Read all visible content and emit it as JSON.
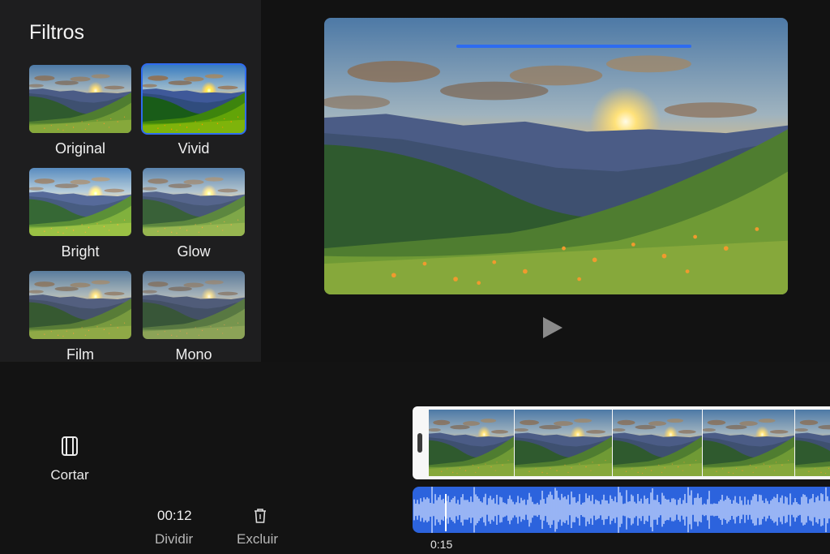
{
  "panel": {
    "title": "Filtros"
  },
  "filters": [
    {
      "label": "Original",
      "selected": false
    },
    {
      "label": "Vivid",
      "selected": true
    },
    {
      "label": "Bright",
      "selected": false
    },
    {
      "label": "Glow",
      "selected": false
    },
    {
      "label": "Film",
      "selected": false
    },
    {
      "label": "Mono",
      "selected": false
    }
  ],
  "preview": {
    "progress_fraction": 0.5
  },
  "controls": {
    "play_icon": "play-icon"
  },
  "tools": {
    "crop_label": "Cortar",
    "crop_icon": "crop-icon",
    "time": "00:12",
    "split_label": "Dividir",
    "delete_icon": "trash-icon",
    "delete_label": "Excluir"
  },
  "timeline": {
    "playhead_time": "0:15"
  },
  "colors": {
    "accent": "#2e6cf0",
    "audio_track": "#2c63dd",
    "background": "#121212",
    "panel": "#1e1e1f"
  }
}
